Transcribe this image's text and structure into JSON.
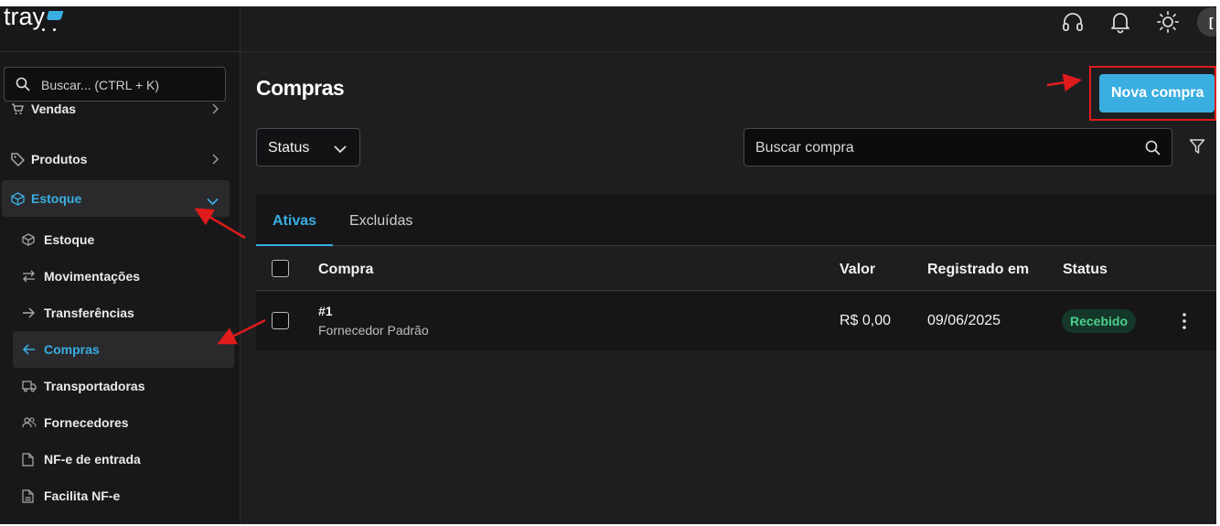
{
  "logo": {
    "text": "tray"
  },
  "sidebar": {
    "search_placeholder": "Buscar... (CTRL + K)",
    "items": [
      {
        "label": "Vendas",
        "icon": "cart-icon"
      },
      {
        "label": "Produtos",
        "icon": "tag-icon"
      },
      {
        "label": "Estoque",
        "icon": "box-icon",
        "expanded": true
      }
    ],
    "sub_items": [
      {
        "label": "Estoque",
        "icon": "box-icon"
      },
      {
        "label": "Movimentações",
        "icon": "swap-icon"
      },
      {
        "label": "Transferências",
        "icon": "arrow-right-icon"
      },
      {
        "label": "Compras",
        "icon": "arrow-left-icon",
        "active": true
      },
      {
        "label": "Transportadoras",
        "icon": "truck-icon"
      },
      {
        "label": "Fornecedores",
        "icon": "users-icon"
      },
      {
        "label": "NF-e de entrada",
        "icon": "document-icon"
      },
      {
        "label": "Facilita NF-e",
        "icon": "document-icon"
      }
    ]
  },
  "topbar": {
    "icons": [
      "headset-icon",
      "bell-icon",
      "sun-icon"
    ],
    "avatar_initial": "[",
    "active_color": "#3aaee0"
  },
  "main": {
    "title": "Compras",
    "new_button": "Nova compra",
    "status_filter": "Status",
    "search_placeholder": "Buscar compra",
    "tabs": [
      {
        "label": "Ativas",
        "active": true
      },
      {
        "label": "Excluídas",
        "active": false
      }
    ],
    "table": {
      "columns": [
        "Compra",
        "Valor",
        "Registrado em",
        "Status"
      ],
      "rows": [
        {
          "id": "#1",
          "supplier": "Fornecedor Padrão",
          "value": "R$ 0,00",
          "date": "09/06/2025",
          "status": "Recebido"
        }
      ]
    }
  }
}
